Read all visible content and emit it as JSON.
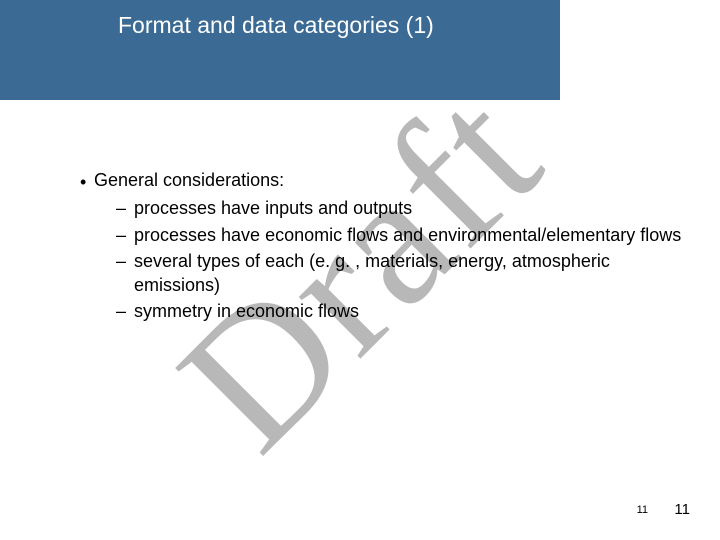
{
  "title": "Format and data categories (1)",
  "watermark": "Draft",
  "main": {
    "heading": "General considerations:",
    "items": [
      "processes have inputs and outputs",
      "processes have economic flows and environmental/elementary flows",
      "several types of each (e. g. , materials, energy, atmospheric emissions)",
      "symmetry in economic flows"
    ]
  },
  "page_inner": "11",
  "page_outer": "11"
}
